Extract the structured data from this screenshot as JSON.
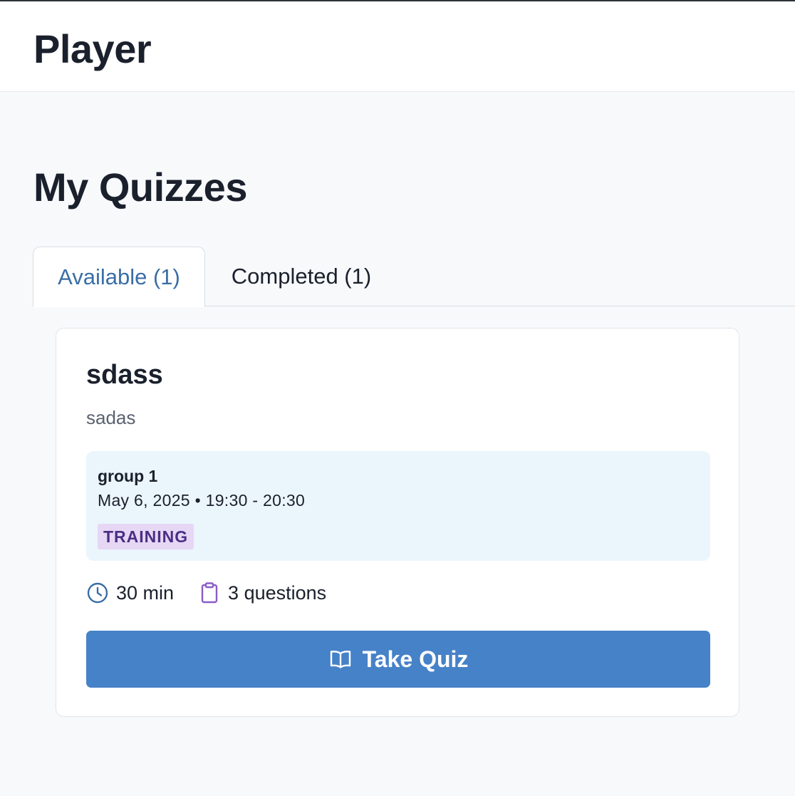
{
  "header": {
    "title": "Player"
  },
  "page": {
    "title": "My Quizzes"
  },
  "tabs": [
    {
      "label": "Available (1)",
      "active": true
    },
    {
      "label": "Completed (1)",
      "active": false
    }
  ],
  "quiz": {
    "title": "sdass",
    "description": "sadas",
    "schedule": {
      "group": "group 1",
      "time": "May 6, 2025 • 19:30 - 20:30",
      "tag": "TRAINING"
    },
    "duration": "30 min",
    "questions": "3 questions",
    "duration_icon": "clock-icon",
    "questions_icon": "clipboard-icon",
    "button_label": "Take Quiz",
    "button_icon": "book-open-icon"
  },
  "colors": {
    "accent": "#4682c8",
    "active_tab_text": "#3a6ea5",
    "schedule_bg": "#ebf5fc",
    "tag_bg": "#e6d7f5",
    "tag_text": "#4b2e83",
    "clock_icon": "#3a6ea5",
    "clipboard_icon": "#8a5cc7"
  }
}
